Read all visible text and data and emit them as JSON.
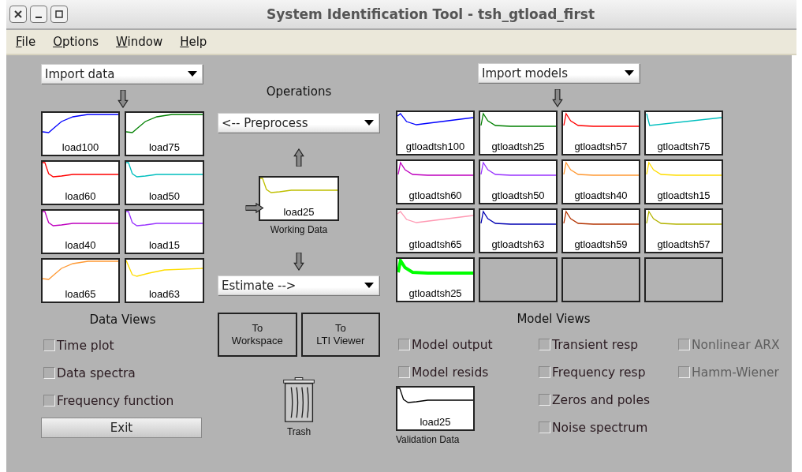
{
  "window": {
    "title": "System Identification Tool - tsh_gtload_first"
  },
  "menu": [
    "File",
    "Options",
    "Window",
    "Help"
  ],
  "data_panel": {
    "import": "Import data",
    "tiles": [
      {
        "label": "load100",
        "color": "#0000ff",
        "kind": "rise"
      },
      {
        "label": "load75",
        "color": "#008000",
        "kind": "rise"
      },
      {
        "label": "load60",
        "color": "#ff0000",
        "kind": "drop"
      },
      {
        "label": "load50",
        "color": "#00bfbf",
        "kind": "drop"
      },
      {
        "label": "load40",
        "color": "#bf00bf",
        "kind": "drop"
      },
      {
        "label": "load15",
        "color": "#9933ff",
        "kind": "drop"
      },
      {
        "label": "load65",
        "color": "#ff9933",
        "kind": "rise"
      },
      {
        "label": "load63",
        "color": "#ffdd00",
        "kind": "dip"
      }
    ],
    "views_title": "Data Views",
    "views": [
      {
        "label": "Time plot",
        "checked": false
      },
      {
        "label": "Data spectra",
        "checked": false
      },
      {
        "label": "Frequency function",
        "checked": false
      }
    ],
    "exit": "Exit"
  },
  "operations": {
    "title": "Operations",
    "preprocess": "<-- Preprocess",
    "working": {
      "label": "load25",
      "color": "#bfbf00",
      "kind": "drop",
      "caption": "Working Data"
    },
    "estimate": "Estimate -->",
    "buttons": [
      [
        "To",
        "Workspace"
      ],
      [
        "To",
        "LTI Viewer"
      ]
    ],
    "trash": "Trash"
  },
  "model_panel": {
    "import": "Import models",
    "tiles": [
      {
        "label": "gtloadtsh100",
        "color": "#0000ff",
        "kind": "peak-dip",
        "selected": false
      },
      {
        "label": "gtloadtsh25",
        "color": "#008000",
        "kind": "peak",
        "selected": false
      },
      {
        "label": "gtloadtsh57",
        "color": "#ff0000",
        "kind": "peak",
        "selected": false
      },
      {
        "label": "gtloadtsh75",
        "color": "#00bfbf",
        "kind": "dip-rise",
        "selected": false
      },
      {
        "label": "gtloadtsh60",
        "color": "#bf00bf",
        "kind": "peak",
        "selected": false
      },
      {
        "label": "gtloadtsh50",
        "color": "#9933ff",
        "kind": "peak",
        "selected": false
      },
      {
        "label": "gtloadtsh40",
        "color": "#ff9933",
        "kind": "peak",
        "selected": false
      },
      {
        "label": "gtloadtsh15",
        "color": "#ffdd00",
        "kind": "peak",
        "selected": false
      },
      {
        "label": "gtloadtsh65",
        "color": "#ff99b3",
        "kind": "peak-dip",
        "selected": false
      },
      {
        "label": "gtloadtsh63",
        "color": "#0000b3",
        "kind": "peak",
        "selected": false
      },
      {
        "label": "gtloadtsh59",
        "color": "#b33300",
        "kind": "peak",
        "selected": false
      },
      {
        "label": "gtloadtsh57",
        "color": "#b3b300",
        "kind": "peak",
        "selected": false
      },
      {
        "label": "gtloadtsh25",
        "color": "#00ff00",
        "kind": "peak",
        "selected": true
      },
      {
        "kind": "empty"
      },
      {
        "kind": "empty"
      },
      {
        "kind": "empty"
      }
    ],
    "views_title": "Model Views",
    "view_columns": [
      [
        {
          "label": "Model output",
          "checked": false,
          "disabled": false
        },
        {
          "label": "Model resids",
          "checked": false,
          "disabled": false
        }
      ],
      [
        {
          "label": "Transient resp",
          "checked": false,
          "disabled": false
        },
        {
          "label": "Frequency resp",
          "checked": false,
          "disabled": false
        },
        {
          "label": "Zeros and poles",
          "checked": false,
          "disabled": false
        },
        {
          "label": "Noise spectrum",
          "checked": false,
          "disabled": false
        }
      ],
      [
        {
          "label": "Nonlinear ARX",
          "checked": false,
          "disabled": true
        },
        {
          "label": "Hamm-Wiener",
          "checked": false,
          "disabled": true
        }
      ]
    ],
    "validation": {
      "label": "load25",
      "color": "#000000",
      "kind": "drop",
      "caption": "Validation Data"
    }
  }
}
